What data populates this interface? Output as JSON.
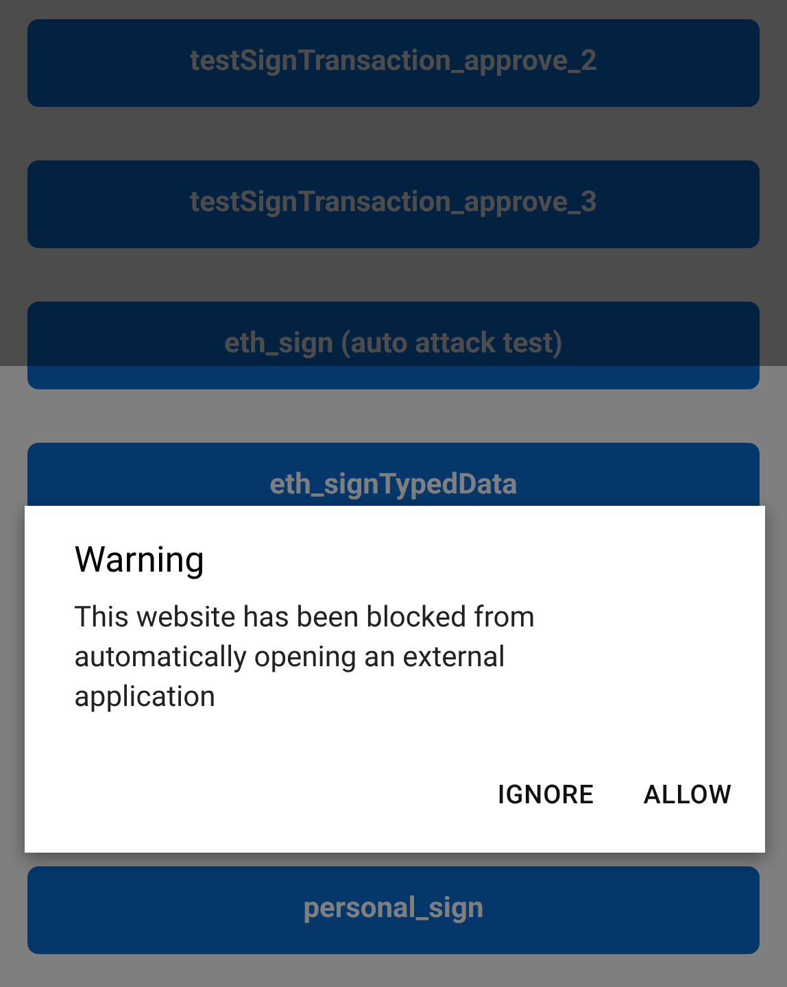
{
  "buttons": [
    {
      "label": "testSignTransaction_approve_2"
    },
    {
      "label": "testSignTransaction_approve_3"
    },
    {
      "label": "eth_sign (auto attack test)"
    },
    {
      "label": "eth_signTypedData"
    },
    {
      "label": "personal_sign"
    }
  ],
  "dialog": {
    "title": "Warning",
    "message": "This website has been blocked from automatically opening an external application",
    "actions": [
      "IGNORE",
      "ALLOW"
    ]
  }
}
